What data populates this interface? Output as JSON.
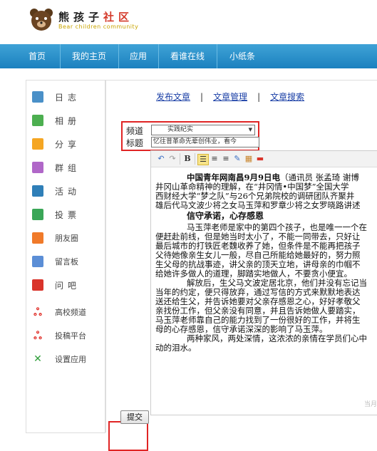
{
  "site": {
    "name_part1": "熊孩子",
    "name_part2": "社区",
    "subtitle": "Bear children community"
  },
  "nav": {
    "items": [
      "首页",
      "我的主页",
      "应用",
      "看谁在线",
      "小纸条"
    ]
  },
  "sidebar": {
    "items": [
      {
        "label": "日志",
        "icon": "blog-icon",
        "color": "#4a90c8"
      },
      {
        "label": "相册",
        "icon": "album-icon",
        "color": "#4caf50"
      },
      {
        "label": "分享",
        "icon": "share-icon",
        "color": "#f5a623"
      },
      {
        "label": "群组",
        "icon": "group-icon",
        "color": "#b067c8"
      },
      {
        "label": "活动",
        "icon": "event-icon",
        "color": "#2f7fb8"
      },
      {
        "label": "投票",
        "icon": "vote-icon",
        "color": "#3aa657"
      },
      {
        "label": "朋友圈",
        "icon": "friends-icon",
        "color": "#f07a2a"
      },
      {
        "label": "留言板",
        "icon": "message-board-icon",
        "color": "#5b8ed6"
      },
      {
        "label": "问吧",
        "icon": "question-icon",
        "color": "#d9342b"
      },
      {
        "label": "高校频道",
        "icon": "college-channel-icon",
        "color": "#e0302a"
      },
      {
        "label": "投稿平台",
        "icon": "submission-icon",
        "color": "#e0302a"
      },
      {
        "label": "设置应用",
        "icon": "settings-app-icon",
        "color": "#2f9e3a"
      }
    ]
  },
  "links": {
    "publish": "发布文章",
    "manage": "文章管理",
    "search": "文章搜索",
    "separator": "|"
  },
  "form": {
    "channel_label": "频道",
    "channel_value": "实践纪实",
    "title_label": "标题",
    "title_value": "忆往昔革命先辈创伟业，看今"
  },
  "toolbar": {
    "bold": "B"
  },
  "article": {
    "lines": [
      {
        "style": "first",
        "bold": "中国青年网南昌9月9日电",
        "text": "（通讯员 张孟琦 谢博"
      },
      {
        "style": "plain",
        "text": "井冈山革命精神的理解，在“井冈情•中国梦”全国大学"
      },
      {
        "style": "plain",
        "text": "西财经大学“梦之队”与26个兄弟院校的调研团队齐聚井"
      },
      {
        "style": "plain",
        "text": "雄后代马文波少将之女马玉萍和罗章少将之女罗晓路讲述"
      },
      {
        "style": "heading",
        "text": "信守承诺，心存感恩"
      },
      {
        "style": "para",
        "text": "马玉萍老师是家中的第四个孩子，也是唯一一个在"
      },
      {
        "style": "plain",
        "text": "便赶赴前线，但是她当时太小了，不能一同带去，只好让"
      },
      {
        "style": "plain",
        "text": "最后城市的打铁匠老魏收养了她，但条件是不能再把孩子"
      },
      {
        "style": "plain",
        "text": "父待她像亲生女儿一般，尽自己所能给她最好的，努力照"
      },
      {
        "style": "plain",
        "text": "生父母的抗战事迹，讲父亲的顶天立地，讲母亲的巾帼不"
      },
      {
        "style": "plain",
        "text": "给她许多做人的道理，脚踏实地做人，不要贪小便宜。"
      },
      {
        "style": "para",
        "text": "解放后，生父马文波定居北京，他们并没有忘记当"
      },
      {
        "style": "plain",
        "text": "当年的约定，便只得放弃，通过写信的方式来默默地表达"
      },
      {
        "style": "plain",
        "text": "送还给生父，并告诉她要对父亲存感恩之心，好好孝敬父"
      },
      {
        "style": "plain",
        "text": "亲找份工作，但父亲没有同意，并且告诉她做人要踏实，"
      },
      {
        "style": "plain",
        "text": "马玉萍老师靠自己的能力找到了一份很好的工作，并将生"
      },
      {
        "style": "plain",
        "text": "母的心存感恩，信守承诺深深的影响了马玉萍。"
      },
      {
        "style": "para",
        "text": "两种家风，两处深情，这浓浓的亲情在学员们心中"
      },
      {
        "style": "plain",
        "text": "动的泪水。"
      }
    ]
  },
  "editor_footer": {
    "watermark": "当月"
  },
  "submit_label": "提交",
  "colors": {
    "nav_bar": "#1b81bf",
    "link": "#1a3fa6",
    "highlight_box": "#e02424"
  }
}
